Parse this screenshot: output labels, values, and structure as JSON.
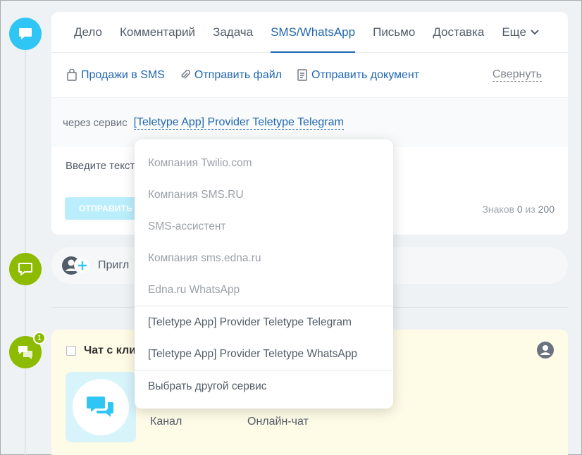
{
  "tabs": [
    {
      "label": "Дело"
    },
    {
      "label": "Комментарий"
    },
    {
      "label": "Задача"
    },
    {
      "label": "SMS/WhatsApp"
    },
    {
      "label": "Письмо"
    },
    {
      "label": "Доставка"
    },
    {
      "label": "Еще"
    }
  ],
  "actions": {
    "sales_sms": "Продажи в SMS",
    "send_file": "Отправить файл",
    "send_document": "Отправить документ",
    "collapse": "Свернуть"
  },
  "service": {
    "prefix": "через сервис",
    "selected": "[Teletype App] Provider Teletype Telegram"
  },
  "editor": {
    "placeholder_visible": "Введите текст",
    "send_label": "ОТПРАВИТЬ",
    "chars_label": "Знаков",
    "chars_count": "0",
    "chars_of": "из",
    "chars_max": "200"
  },
  "invite": {
    "text": "Пригл"
  },
  "chat": {
    "title": "Чат с кли",
    "badge_count": "1",
    "channel_label": "Канал",
    "channel_value": "Онлайн-чат"
  },
  "dropdown": {
    "items_group1": [
      {
        "label": "Компания Twilio.com"
      },
      {
        "label": "Компания SMS.RU"
      },
      {
        "label": "SMS-ассистент"
      },
      {
        "label": "Компания sms.edna.ru"
      },
      {
        "label": "Edna.ru WhatsApp"
      }
    ],
    "items_group2": [
      {
        "label": "[Teletype App] Provider Teletype Telegram"
      },
      {
        "label": "[Teletype App] Provider Teletype WhatsApp"
      }
    ],
    "other": "Выбрать другой сервис"
  },
  "colors": {
    "accent": "#2067b0",
    "timeline_blue": "#2fc6f6",
    "timeline_green": "#8dbb00",
    "chat_bg": "#fefbe6"
  }
}
